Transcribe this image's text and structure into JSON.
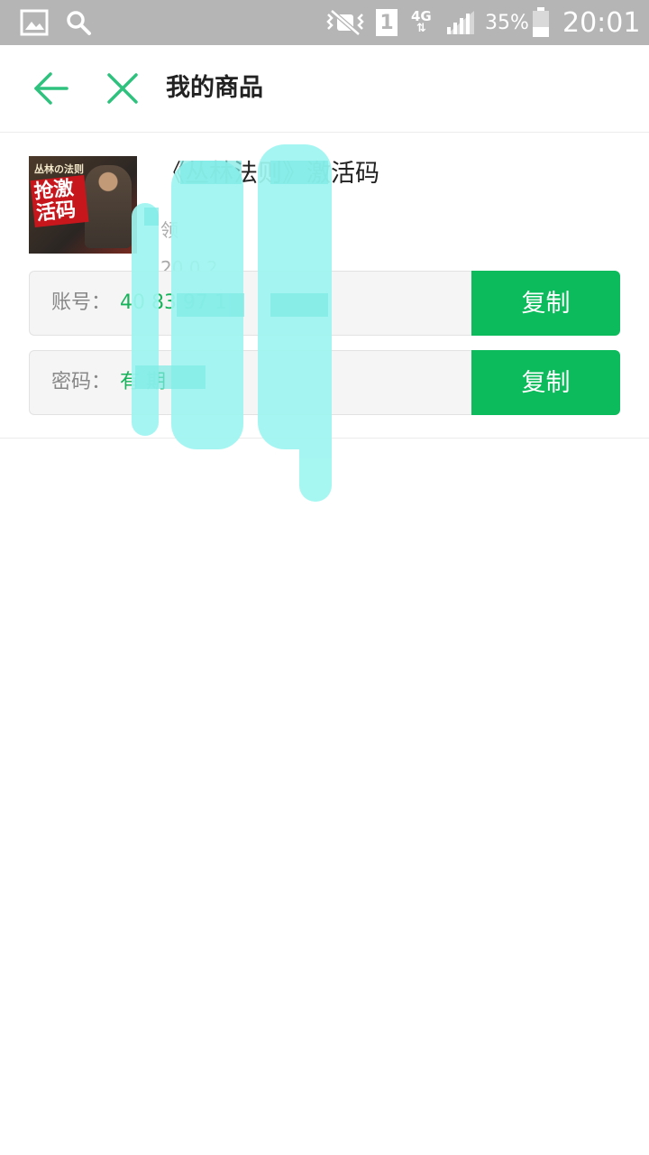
{
  "status_bar": {
    "network": "4G",
    "sim": "1",
    "battery": "35%",
    "time": "20:01",
    "icons": [
      "gallery-icon",
      "search-icon",
      "mute-icon",
      "sim-icon",
      "signal-icon",
      "battery-icon"
    ]
  },
  "nav": {
    "title": "我的商品",
    "back_icon": "arrow-left-icon",
    "close_icon": "close-icon",
    "accent_color": "#2ec27e"
  },
  "product": {
    "thumb_top_text": "丛林の法则",
    "thumb_big_text": "抢激活码",
    "title": "《丛林法则》激活码",
    "subtitle": "领",
    "time": "20 0 2",
    "account_label": "账号：",
    "account_value": "40 83 97 1",
    "password_label": "密码：",
    "password_value": "有 期",
    "copy_label": "复制",
    "button_color": "#0cbb5b"
  }
}
